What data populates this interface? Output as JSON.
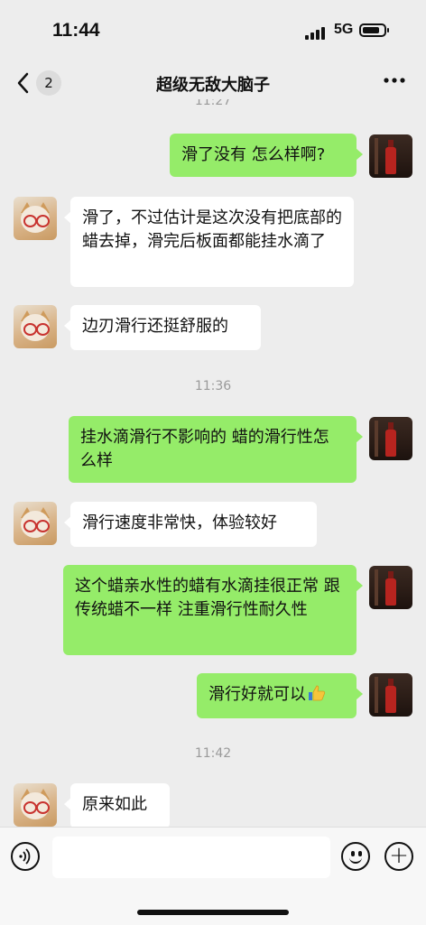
{
  "status": {
    "time": "11:44",
    "network": "5G"
  },
  "nav": {
    "back_icon": "chevron-left-icon",
    "unread_count": "2",
    "title": "超级无敌大脑子",
    "more_icon": "more-dots-icon"
  },
  "timestamps": {
    "top_partial": "11:27",
    "t1": "11:36",
    "t2": "11:42"
  },
  "messages": [
    {
      "side": "right",
      "text": "滑了没有 怎么样啊?"
    },
    {
      "side": "left",
      "text": "滑了，不过估计是这次没有把底部的蜡去掉，滑完后板面都能挂水滴了"
    },
    {
      "side": "left",
      "text": "边刃滑行还挺舒服的"
    },
    {
      "side": "right",
      "text": "挂水滴滑行不影响的 蜡的滑行性怎么样"
    },
    {
      "side": "left",
      "text": "滑行速度非常快，体验较好"
    },
    {
      "side": "right",
      "text": "这个蜡亲水性的蜡有水滴挂很正常 跟传统蜡不一样 注重滑行性耐久性"
    },
    {
      "side": "right",
      "text": "滑行好就可以",
      "emoji": "thumbs-up-icon"
    },
    {
      "side": "left",
      "text": "原来如此"
    }
  ],
  "input": {
    "value": "",
    "placeholder": ""
  },
  "colors": {
    "background": "#ededed",
    "self_bubble": "#95ec69",
    "other_bubble": "#ffffff"
  }
}
